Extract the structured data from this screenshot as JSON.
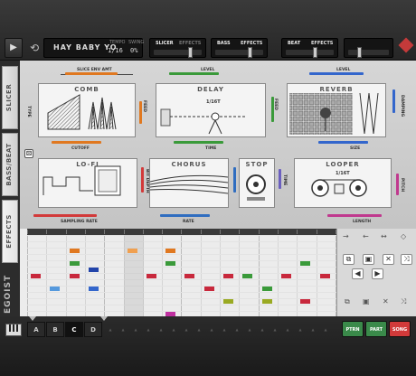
{
  "header": {
    "song_title": "HAY BABY YO",
    "tempo_label": "TEMPO",
    "tempo_value": "1/16",
    "swing_label": "SWING",
    "swing_value": "0%",
    "modules": [
      {
        "name": "SLICER",
        "effects": "EFFECTS",
        "effects_active": false
      },
      {
        "name": "BASS",
        "effects": "EFFECTS",
        "effects_active": true
      },
      {
        "name": "BEAT",
        "effects": "EFFECTS",
        "effects_active": true
      }
    ]
  },
  "left_tabs": [
    "SLICER",
    "BASS/BEAT",
    "EFFECTS"
  ],
  "brand": "EGOIST",
  "effects": {
    "comb": {
      "title": "COMB",
      "top": "SLICE ENV AMT",
      "bottom": "CUTOFF",
      "left": "TYPE",
      "right": "FEED",
      "color": "#e07820"
    },
    "delay": {
      "title": "DELAY",
      "top": "LEVEL",
      "bottom": "TIME",
      "right": "FEED",
      "note": "1/16T",
      "color": "#3a9a3a"
    },
    "reverb": {
      "title": "REVERB",
      "top": "LEVEL",
      "bottom": "SIZE",
      "right": "DAMPING",
      "color": "#3366cc"
    },
    "lofi": {
      "title": "LO-FI",
      "bottom": "SAMPLING RATE",
      "right": "BIT DEPTH",
      "color": "#d23a3a"
    },
    "chorus": {
      "title": "CHORUS",
      "bottom": "RATE",
      "right": "DEPTH",
      "color": "#2f6dc0"
    },
    "stop": {
      "title": "STOP",
      "right": "TIME",
      "color": "#6b5fbf"
    },
    "looper": {
      "title": "LOOPER",
      "bottom": "LENGTH",
      "right": "PITCH",
      "note": "1/16T",
      "color": "#c0398e"
    }
  },
  "patterns": [
    "A",
    "B",
    "C",
    "D"
  ],
  "selected_pattern": "C",
  "modes": [
    {
      "label": "PTRN",
      "color": "#3a8a4a"
    },
    {
      "label": "PART",
      "color": "#3a8a4a"
    },
    {
      "label": "SONG",
      "color": "#d23a3a"
    }
  ],
  "icons": {
    "play": "play-icon",
    "reload": "reload-icon",
    "keyboard": "keyboard-icon",
    "dice": "dice-icon"
  },
  "sequencer": {
    "note_colors": {
      "orange": "#e07820",
      "light_orange": "#f0a050",
      "red": "#c8283c",
      "green": "#3a9a3a",
      "blue": "#3366cc",
      "light_blue": "#5599dd",
      "olive": "#9aaa22",
      "purple": "#c030a0",
      "navy": "#2244aa"
    }
  }
}
